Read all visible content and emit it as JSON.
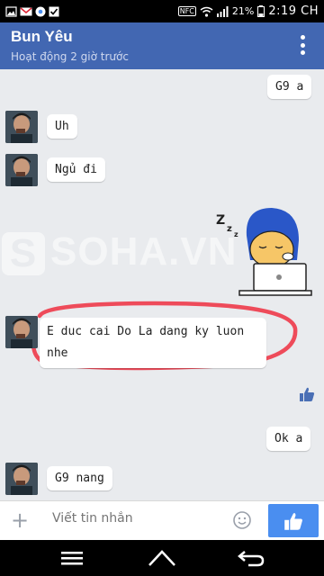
{
  "status_bar": {
    "nfc": "NFC",
    "battery": "21%",
    "time": "2:19 CH"
  },
  "header": {
    "contact_name": "Bun Yêu",
    "presence": "Hoạt động 2 giờ trước"
  },
  "messages": [
    {
      "sender": "me",
      "text": "G9 a"
    },
    {
      "sender": "them",
      "text": "Uh"
    },
    {
      "sender": "them",
      "text": "Ngủ đi"
    },
    {
      "sender": "them",
      "text": "E duc cai Do La dang ky luon nhe"
    },
    {
      "sender": "me",
      "text": "Ok a"
    },
    {
      "sender": "them",
      "text": "G9 nang"
    }
  ],
  "watermark": {
    "letter": "S",
    "text": "SOHA.VN"
  },
  "composer": {
    "placeholder": "Viết tin nhắn"
  },
  "colors": {
    "header_bg": "#4267b2",
    "like_button_bg": "#4a8ef0",
    "highlight_stroke": "#ee4b5a"
  }
}
